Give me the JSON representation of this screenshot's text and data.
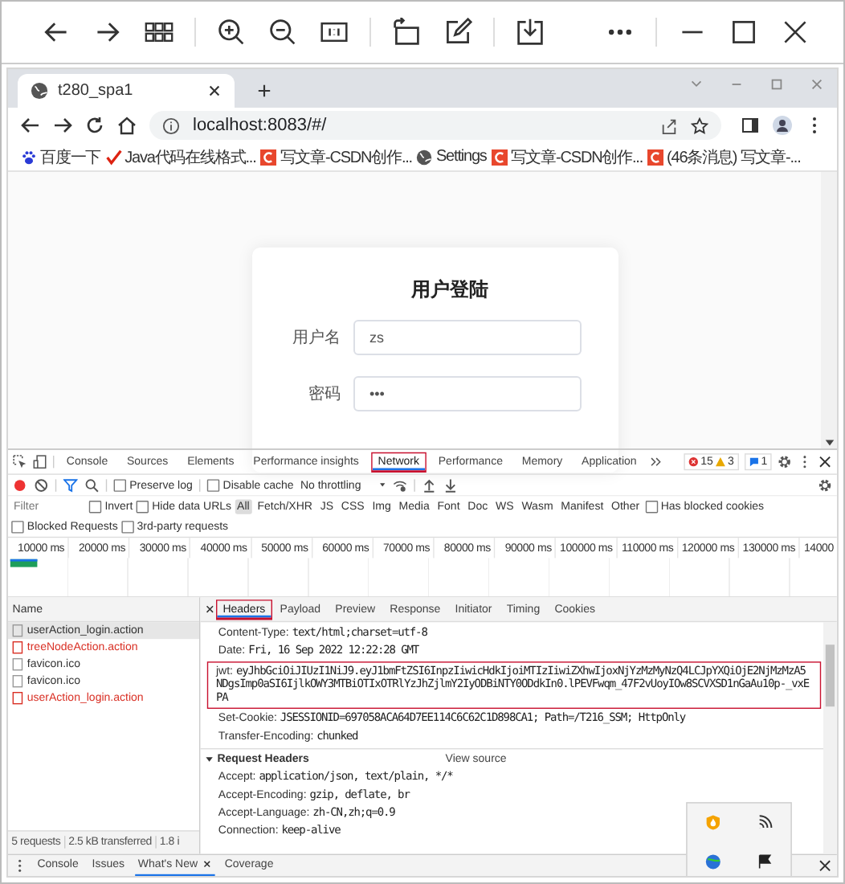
{
  "browser": {
    "tab": {
      "title": "t280_spa1"
    },
    "url": "localhost:8083/#/",
    "bookmarks": [
      {
        "label": "百度一下",
        "kind": "paw"
      },
      {
        "label": "Java代码在线格式...",
        "kind": "check"
      },
      {
        "label": "写文章-CSDN创作...",
        "kind": "csdn"
      },
      {
        "label": "Settings",
        "kind": "globe"
      },
      {
        "label": "写文章-CSDN创作...",
        "kind": "csdn"
      },
      {
        "label": "(46条消息) 写文章-...",
        "kind": "csdn"
      }
    ]
  },
  "login": {
    "title": "用户登陆",
    "fields": [
      {
        "label": "用户名",
        "value": "zs"
      },
      {
        "label": "密码",
        "value": "•••"
      }
    ]
  },
  "devtools": {
    "tabs": [
      {
        "label": "Console",
        "selected": false,
        "highlighted": false
      },
      {
        "label": "Sources",
        "selected": false,
        "highlighted": false
      },
      {
        "label": "Elements",
        "selected": false,
        "highlighted": false
      },
      {
        "label": "Performance insights",
        "selected": false,
        "highlighted": false
      },
      {
        "label": "Network",
        "selected": true,
        "highlighted": true
      },
      {
        "label": "Performance",
        "selected": false,
        "highlighted": false
      },
      {
        "label": "Memory",
        "selected": false,
        "highlighted": false
      },
      {
        "label": "Application",
        "selected": false,
        "highlighted": false
      }
    ],
    "errors": "15",
    "warnings": "3",
    "messages": "1",
    "preserve_log": {
      "label": "Preserve log",
      "checked": false
    },
    "disable_cache": {
      "label": "Disable cache",
      "checked": false
    },
    "throttling": "No throttling",
    "filter": {
      "placeholder": "Filter"
    },
    "filter_checks": [
      {
        "label": "Invert",
        "checked": false
      },
      {
        "label": "Hide data URLs",
        "checked": false
      }
    ],
    "types": [
      {
        "label": "All",
        "selected": true
      },
      {
        "label": "Fetch/XHR",
        "selected": false
      },
      {
        "label": "JS",
        "selected": false
      },
      {
        "label": "CSS",
        "selected": false
      },
      {
        "label": "Img",
        "selected": false
      },
      {
        "label": "Media",
        "selected": false
      },
      {
        "label": "Font",
        "selected": false
      },
      {
        "label": "Doc",
        "selected": false
      },
      {
        "label": "WS",
        "selected": false
      },
      {
        "label": "Wasm",
        "selected": false
      },
      {
        "label": "Manifest",
        "selected": false
      },
      {
        "label": "Other",
        "selected": false
      }
    ],
    "blocked_cookies": {
      "label": "Has blocked cookies",
      "checked": false
    },
    "more_checks": [
      {
        "label": "Blocked Requests",
        "checked": false
      },
      {
        "label": "3rd-party requests",
        "checked": false
      }
    ],
    "ticks": [
      "10000 ms",
      "20000 ms",
      "30000 ms",
      "40000 ms",
      "50000 ms",
      "60000 ms",
      "70000 ms",
      "80000 ms",
      "90000 ms",
      "100000 ms",
      "110000 ms",
      "120000 ms",
      "130000 ms",
      "14000"
    ],
    "name_header": "Name",
    "requests": [
      {
        "name": "userAction_login.action",
        "failed": false,
        "selected": true
      },
      {
        "name": "treeNodeAction.action",
        "failed": true,
        "selected": false
      },
      {
        "name": "favicon.ico",
        "failed": false,
        "selected": false
      },
      {
        "name": "favicon.ico",
        "failed": false,
        "selected": false
      },
      {
        "name": "userAction_login.action",
        "failed": true,
        "selected": false
      }
    ],
    "detail_tabs": [
      {
        "label": "Headers",
        "selected": true,
        "highlighted": true
      },
      {
        "label": "Payload",
        "selected": false,
        "highlighted": false
      },
      {
        "label": "Preview",
        "selected": false,
        "highlighted": false
      },
      {
        "label": "Response",
        "selected": false,
        "highlighted": false
      },
      {
        "label": "Initiator",
        "selected": false,
        "highlighted": false
      },
      {
        "label": "Timing",
        "selected": false,
        "highlighted": false
      },
      {
        "label": "Cookies",
        "selected": false,
        "highlighted": false
      }
    ],
    "response_headers": [
      {
        "name": "Content-Type:",
        "value": "text/html;charset=utf-8",
        "highlighted": false
      },
      {
        "name": "Date:",
        "value": "Fri, 16 Sep 2022 12:22:28 GMT",
        "highlighted": false
      },
      {
        "name": "jwt:",
        "value": "eyJhbGciOiJIUzI1NiJ9.eyJ1bmFtZSI6InpzIiwicHdkIjoiMTIzIiwiZXhwIjoxNjYzMzMyNzQ4LCJpYXQiOjE2NjMzMzA5NDgsImp0aSI6IjlkOWY3MTBiOTIxOTRlYzJhZjlmY2IyODBiNTY0ODdkIn0.lPEVFwqm_47F2vUoyIOw8SCVXSD1nGaAu10p-_vxEPA",
        "highlighted": true
      },
      {
        "name": "Set-Cookie:",
        "value": "JSESSIONID=697058ACA64D7EE114C6C62C1D898CA1; Path=/T216_SSM; HttpOnly",
        "highlighted": false
      },
      {
        "name": "Transfer-Encoding:",
        "value": "chunked",
        "highlighted": false
      }
    ],
    "request_headers": {
      "title": "Request Headers",
      "expanded": true,
      "view_source": "View source",
      "items": [
        {
          "name": "Accept:",
          "value": "application/json, text/plain, */*"
        },
        {
          "name": "Accept-Encoding:",
          "value": "gzip, deflate, br"
        },
        {
          "name": "Accept-Language:",
          "value": "zh-CN,zh;q=0.9"
        },
        {
          "name": "Connection:",
          "value": "keep-alive"
        }
      ]
    },
    "status": [
      "5 requests",
      "2.5 kB transferred",
      "1.8 i"
    ],
    "drawer_tabs": [
      {
        "label": "Console",
        "selected": false,
        "closable": false
      },
      {
        "label": "Issues",
        "selected": false,
        "closable": false
      },
      {
        "label": "What's New",
        "selected": true,
        "closable": true
      },
      {
        "label": "Coverage",
        "selected": false,
        "closable": false
      }
    ]
  }
}
